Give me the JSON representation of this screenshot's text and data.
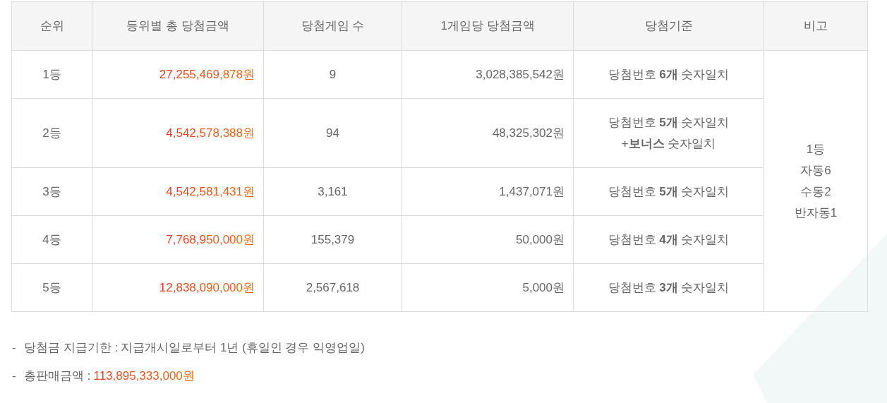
{
  "table": {
    "columns": [
      "순위",
      "등위별 총 당첨금액",
      "당첨게임 수",
      "1게임당 당첨금액",
      "당첨기준",
      "비고"
    ],
    "rows": [
      {
        "rank": "1등",
        "total": "27,255,469,878원",
        "games": "9",
        "per_game": "3,028,385,542원",
        "criteria": [
          "당첨번호 **6개** 숫자일치"
        ]
      },
      {
        "rank": "2등",
        "total": "4,542,578,388원",
        "games": "94",
        "per_game": "48,325,302원",
        "criteria": [
          "당첨번호 **5개** 숫자일치",
          "+**보너스** 숫자일치"
        ]
      },
      {
        "rank": "3등",
        "total": "4,542,581,431원",
        "games": "3,161",
        "per_game": "1,437,071원",
        "criteria": [
          "당첨번호 **5개** 숫자일치"
        ]
      },
      {
        "rank": "4등",
        "total": "7,768,950,000원",
        "games": "155,379",
        "per_game": "50,000원",
        "criteria": [
          "당첨번호 **4개** 숫자일치"
        ]
      },
      {
        "rank": "5등",
        "total": "12,838,090,000원",
        "games": "2,567,618",
        "per_game": "5,000원",
        "criteria": [
          "당첨번호 **3개** 숫자일치"
        ]
      }
    ],
    "remarks": [
      "1등",
      "자동6",
      "수동2",
      "반자동1"
    ]
  },
  "notes": [
    {
      "bullet": "-",
      "label": "당첨금 지급기한 :",
      "value": "지급개시일로부터 1년 (휴일인 경우 익영업일)",
      "kind": "plain"
    },
    {
      "bullet": "-",
      "label": "총판매금액 :",
      "value": "113,895,333,000원",
      "kind": "amount"
    }
  ]
}
